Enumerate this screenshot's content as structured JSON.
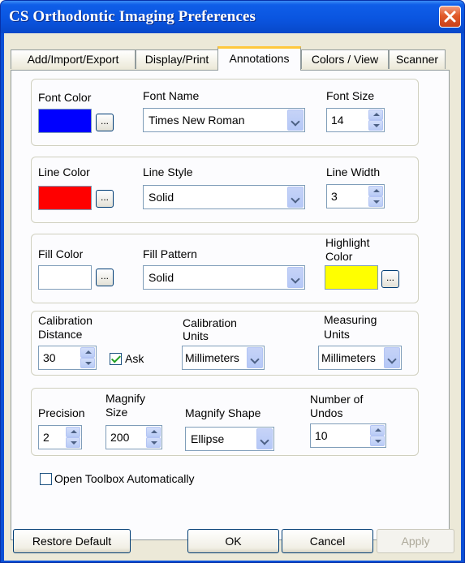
{
  "window": {
    "title": "CS Orthodontic Imaging Preferences"
  },
  "tabs": [
    "Add/Import/Export",
    "Display/Print",
    "Annotations",
    "Colors / View",
    "Scanner"
  ],
  "font": {
    "color_label": "Font Color",
    "color": "#0000ff",
    "name_label": "Font Name",
    "name_value": "Times New Roman",
    "size_label": "Font Size",
    "size_value": "14"
  },
  "line": {
    "color_label": "Line Color",
    "color": "#ff0000",
    "style_label": "Line Style",
    "style_value": "Solid",
    "width_label": "Line Width",
    "width_value": "3"
  },
  "fill": {
    "color_label": "Fill Color",
    "color": "#ffffff",
    "pattern_label": "Fill Pattern",
    "pattern_value": "Solid",
    "highlight_label_1": "Highlight",
    "highlight_label_2": "Color",
    "highlight_color": "#ffff00"
  },
  "calibration": {
    "distance_label_1": "Calibration",
    "distance_label_2": "Distance",
    "distance_value": "30",
    "ask_label": "Ask",
    "ask_checked": true,
    "units_label_1": "Calibration",
    "units_label_2": "Units",
    "units_value": "Millimeters",
    "measuring_label_1": "Measuring",
    "measuring_label_2": "Units",
    "measuring_value": "Millimeters"
  },
  "misc": {
    "precision_label": "Precision",
    "precision_value": "2",
    "magnify_size_label_1": "Magnify",
    "magnify_size_label_2": "Size",
    "magnify_size_value": "200",
    "magnify_shape_label": "Magnify Shape",
    "magnify_shape_value": "Ellipse",
    "undos_label_1": "Number of",
    "undos_label_2": "Undos",
    "undos_value": "10"
  },
  "toolbox": {
    "label": "Open Toolbox Automatically",
    "checked": false
  },
  "buttons": {
    "dots": "...",
    "restore": "Restore Default",
    "ok": "OK",
    "cancel": "Cancel",
    "apply": "Apply"
  }
}
